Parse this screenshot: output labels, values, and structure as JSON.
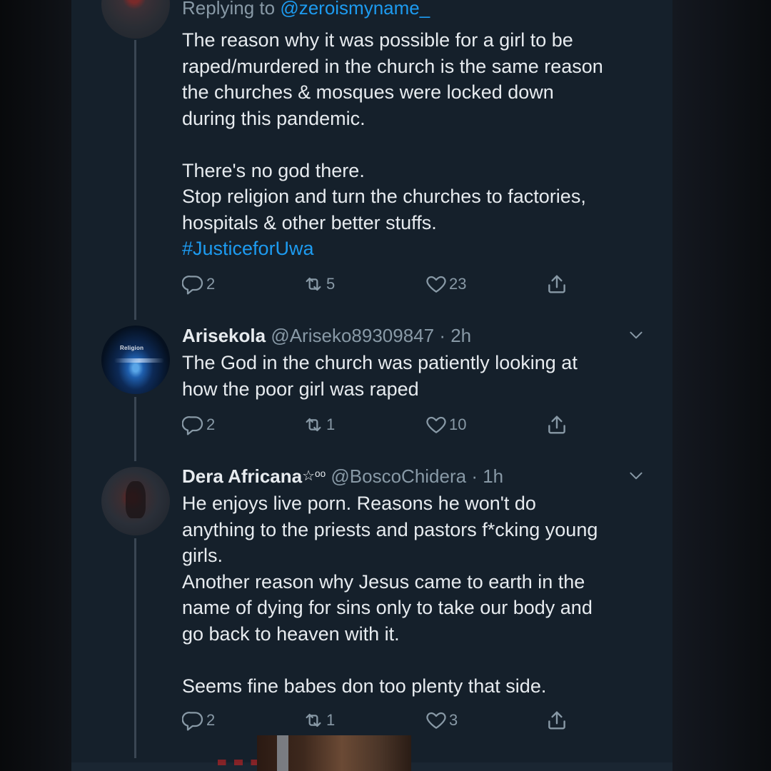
{
  "reply_context": {
    "prefix": "Replying to",
    "handle": "@zeroismyname_"
  },
  "tweets": [
    {
      "lines": [
        "The reason why it was possible for a girl to be",
        "raped/murdered in the church is the same reason",
        "the churches & mosques were locked down",
        "during this pandemic.",
        "",
        "There's no god there.",
        "Stop religion and  turn the churches to factories,",
        "hospitals & other better stuffs."
      ],
      "hashtag": "#JusticeforUwa",
      "replies": "2",
      "retweets": "5",
      "likes": "23"
    },
    {
      "name": "Arisekola",
      "handle": "@Ariseko89309847",
      "time": "· 2h",
      "avatar_text": "Religion",
      "lines": [
        "The God in the church was patiently looking at",
        "how the poor girl was  raped"
      ],
      "replies": "2",
      "retweets": "1",
      "likes": "10"
    },
    {
      "name": "Dera Africana",
      "name_suffix": "☆ᵒᵒ",
      "handle": "@BoscoChidera",
      "time": "· 1h",
      "lines": [
        "He enjoys live porn. Reasons he won't do",
        "anything to the priests and pastors f*cking young",
        "girls.",
        "Another reason why Jesus came to earth in the",
        "name of dying for sins only to take our body and",
        "go back to heaven with it.",
        "",
        "Seems fine babes don too plenty that side."
      ],
      "replies": "2",
      "retweets": "1",
      "likes": "3"
    }
  ],
  "icons": {
    "reply": "reply-icon",
    "retweet": "retweet-icon",
    "like": "heart-icon",
    "share": "share-icon",
    "more": "chevron-down-icon"
  },
  "colors": {
    "background": "#15202b",
    "text": "#e7ebef",
    "muted": "#8899a6",
    "link": "#1d9bf0"
  }
}
